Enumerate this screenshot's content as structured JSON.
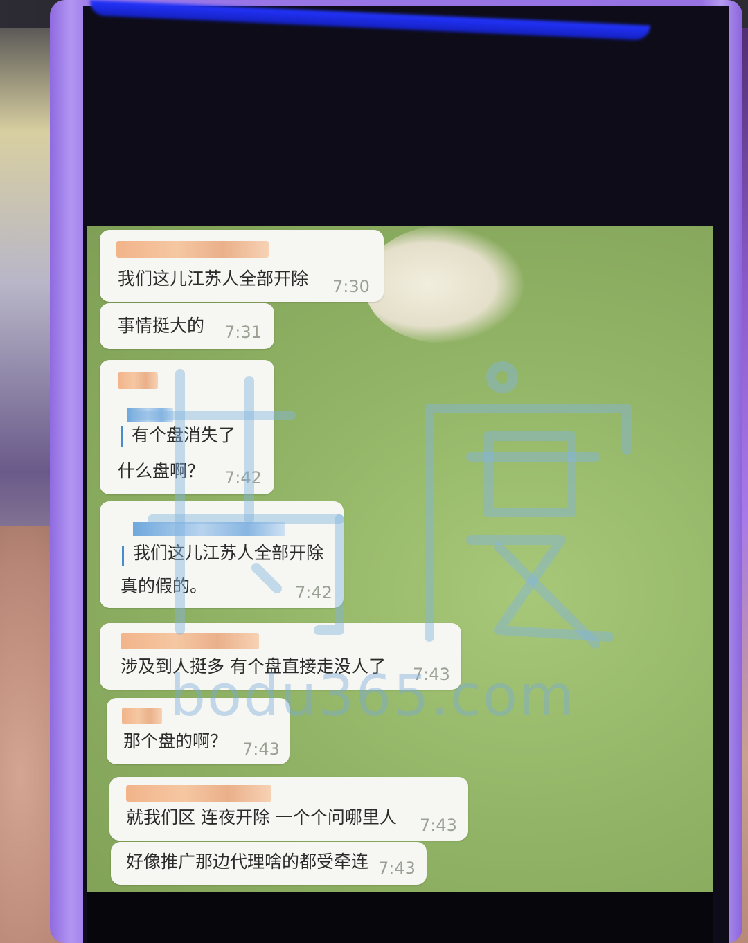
{
  "watermark": {
    "text": "bodu365.com"
  },
  "messages": [
    {
      "text": "我们这儿江苏人全部开除",
      "time": "7:30"
    },
    {
      "text": "事情挺大的",
      "time": "7:31"
    },
    {
      "quote": "有个盘消失了",
      "text": "什么盘啊？",
      "time": "7:42"
    },
    {
      "quote": "我们这儿江苏人全部开除",
      "text": "真的假的。",
      "time": "7:42"
    },
    {
      "text": "涉及到人挺多  有个盘直接走没人了",
      "time": "7:43"
    },
    {
      "text": "那个盘的啊？",
      "time": "7:43"
    },
    {
      "text": "就我们区  连夜开除  一个个问哪里人",
      "time": "7:43"
    },
    {
      "text": "好像推广那边代理啥的都受牵连",
      "time": "7:43"
    }
  ]
}
